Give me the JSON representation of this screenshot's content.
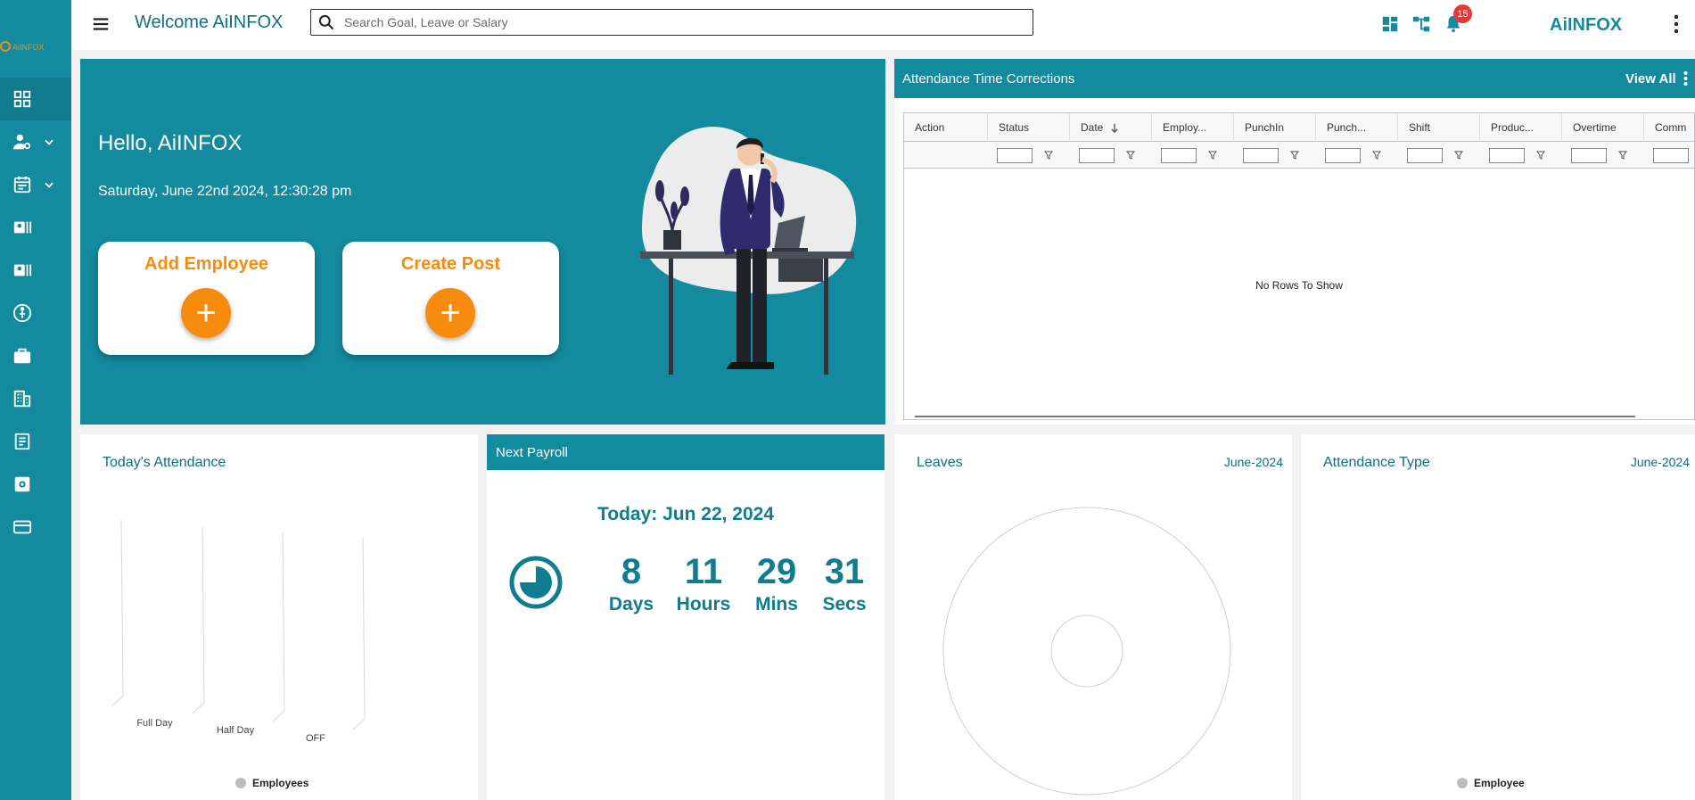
{
  "header": {
    "welcome": "Welcome AiINFOX",
    "search_placeholder": "Search Goal, Leave or Salary",
    "notification_count": "15",
    "brand": "AiINFOX"
  },
  "sidebar": {
    "logo_text": "AiINFOX",
    "items": [
      {
        "icon": "dashboard-icon",
        "active": true
      },
      {
        "icon": "user-settings-icon",
        "expandable": true
      },
      {
        "icon": "calendar-icon",
        "expandable": true
      },
      {
        "icon": "id-card-icon"
      },
      {
        "icon": "id-card-icon"
      },
      {
        "icon": "person-circle-icon"
      },
      {
        "icon": "briefcase-icon"
      },
      {
        "icon": "building-icon"
      },
      {
        "icon": "document-icon"
      },
      {
        "icon": "settings-box-icon"
      },
      {
        "icon": "card-icon"
      }
    ]
  },
  "hero": {
    "greeting": "Hello, AiINFOX",
    "datetime": "Saturday, June 22nd 2024, 12:30:28 pm",
    "add_employee": "Add Employee",
    "create_post": "Create Post",
    "plus": "+"
  },
  "corrections": {
    "title": "Attendance Time Corrections",
    "view_all": "View All",
    "columns": [
      "Action",
      "Status",
      "Date",
      "Employ...",
      "PunchIn",
      "Punch...",
      "Shift",
      "Produc...",
      "Overtime",
      "Comm"
    ],
    "sorted_column": "Date",
    "empty_text": "No Rows To Show"
  },
  "todays_attendance": {
    "title": "Today's Attendance",
    "legend": "Employees",
    "chart_data": {
      "type": "bar",
      "categories": [
        "Full Day",
        "Half Day",
        "OFF"
      ],
      "series": [
        {
          "name": "Employees",
          "values": [
            0,
            0,
            0
          ]
        }
      ],
      "legend_position": "bottom",
      "colors": [
        "#bdbdbd"
      ]
    }
  },
  "payroll": {
    "title": "Next Payroll",
    "today": "Today: Jun 22, 2024",
    "countdown": [
      {
        "value": "8",
        "unit": "Days"
      },
      {
        "value": "11",
        "unit": "Hours"
      },
      {
        "value": "29",
        "unit": "Mins"
      },
      {
        "value": "31",
        "unit": "Secs"
      }
    ]
  },
  "leaves": {
    "title": "Leaves",
    "month": "June-2024",
    "chart_data": {
      "type": "pie",
      "categories": [],
      "values": []
    }
  },
  "attendance_type": {
    "title": "Attendance Type",
    "month": "June-2024",
    "legend": "Employee",
    "chart_data": {
      "type": "pie",
      "categories": [],
      "values": [],
      "legend_position": "bottom"
    }
  },
  "colors": {
    "primary": "#138a9e",
    "accent": "#f68b0e",
    "badge": "#e53935"
  }
}
